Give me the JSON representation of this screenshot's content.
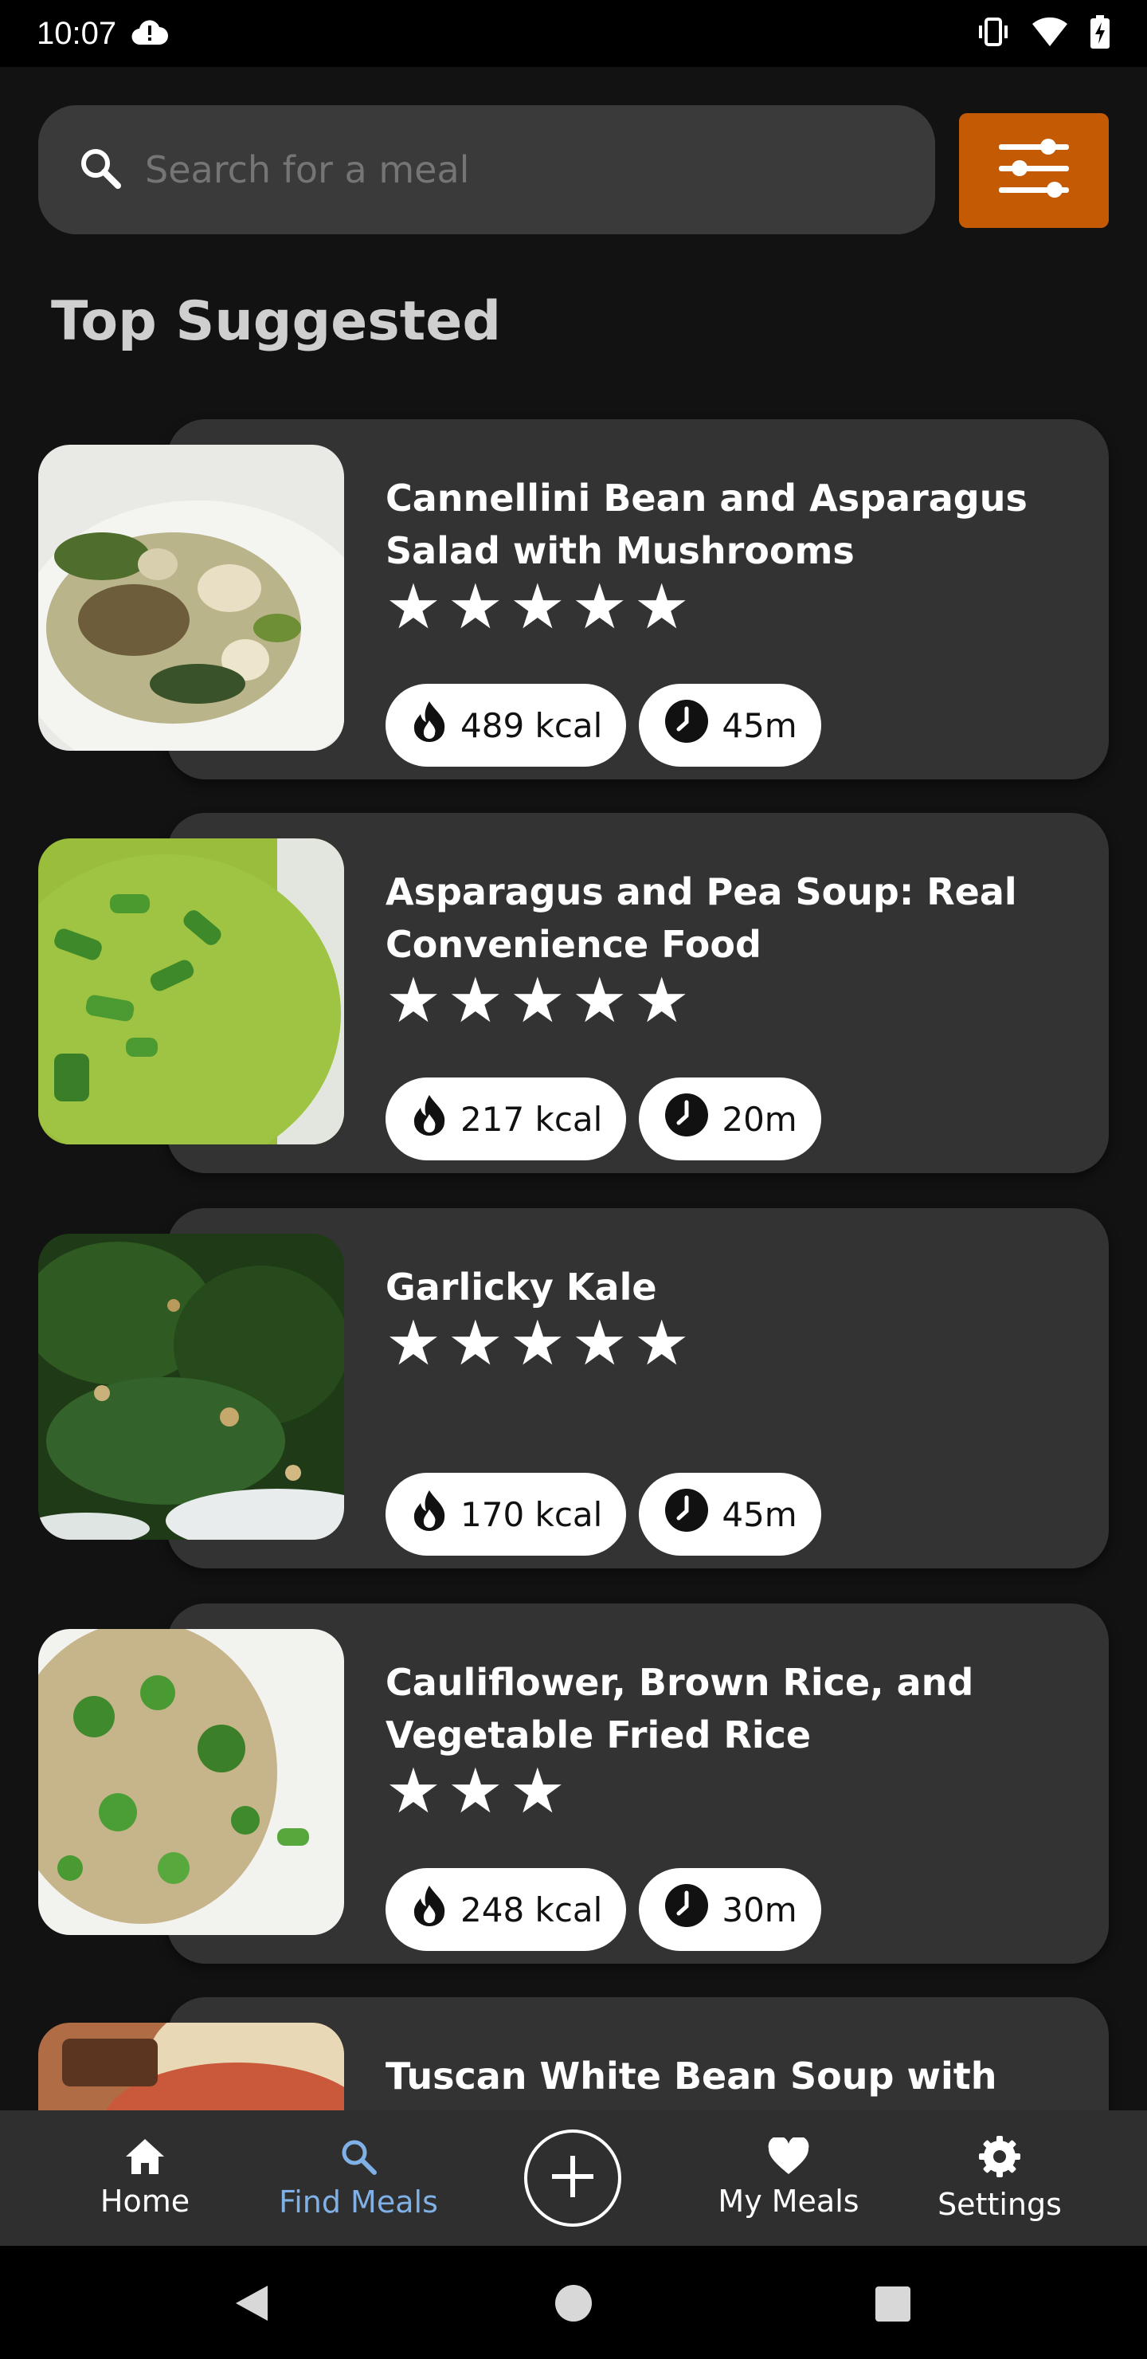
{
  "status_bar": {
    "time": "10:07"
  },
  "search": {
    "placeholder": "Search for a meal"
  },
  "section_title": "Top Suggested",
  "meals": [
    {
      "title": "Cannellini Bean and Asparagus Salad with Mushrooms",
      "stars": "★★★★★",
      "rating": 5,
      "calories": "489 kcal",
      "time": "45m"
    },
    {
      "title": "Asparagus and Pea Soup: Real Convenience Food",
      "stars": "★★★★★",
      "rating": 5,
      "calories": "217 kcal",
      "time": "20m"
    },
    {
      "title": "Garlicky Kale",
      "stars": "★★★★★",
      "rating": 5,
      "calories": "170 kcal",
      "time": "45m"
    },
    {
      "title": "Cauliflower, Brown Rice, and Vegetable Fried Rice",
      "stars": "★★★",
      "rating": 3,
      "calories": "248 kcal",
      "time": "30m"
    },
    {
      "title": "Tuscan White Bean Soup with Olive Oil"
    }
  ],
  "bottom_nav": {
    "home": "Home",
    "find_meals": "Find Meals",
    "my_meals": "My Meals",
    "settings": "Settings",
    "active": "find_meals"
  },
  "colors": {
    "accent": "#c55a05",
    "active_nav": "#7fb0e6",
    "card": "#333333",
    "background": "#121212"
  }
}
